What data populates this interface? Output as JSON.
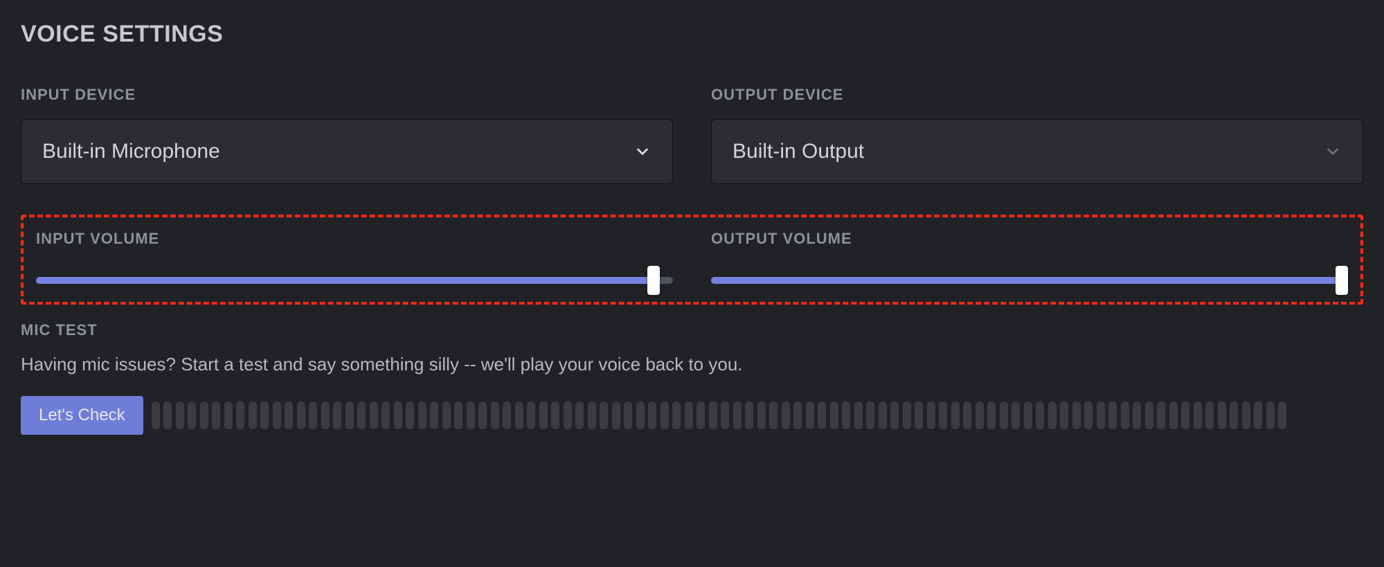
{
  "voice_settings": {
    "title": "VOICE SETTINGS",
    "input_device": {
      "label": "INPUT DEVICE",
      "selected": "Built-in Microphone"
    },
    "output_device": {
      "label": "OUTPUT DEVICE",
      "selected": "Built-in Output"
    },
    "input_volume": {
      "label": "INPUT VOLUME",
      "percent": 97
    },
    "output_volume": {
      "label": "OUTPUT VOLUME",
      "percent": 99
    },
    "mic_test": {
      "label": "MIC TEST",
      "description": "Having mic issues? Start a test and say something silly -- we'll play your voice back to you.",
      "button": "Let's Check"
    }
  }
}
